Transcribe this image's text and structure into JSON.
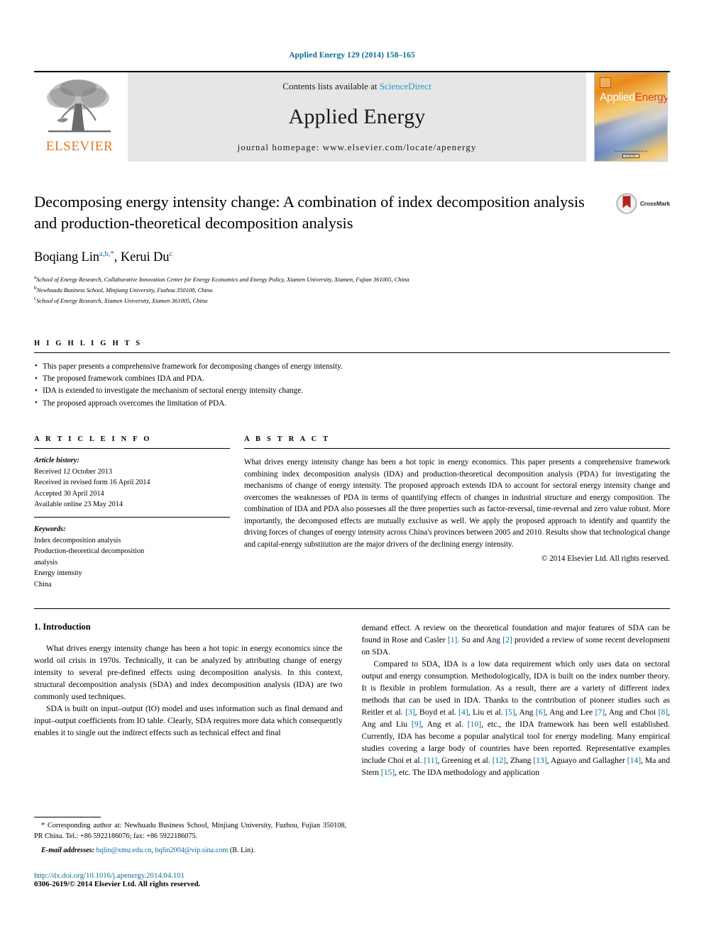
{
  "running_head": "Applied Energy 129 (2014) 158–165",
  "masthead": {
    "publisher_name": "ELSEVIER",
    "contents_prefix": "Contents lists available at ",
    "contents_link": "ScienceDirect",
    "journal_name": "Applied Energy",
    "homepage": "journal homepage: www.elsevier.com/locate/apenergy",
    "cover": {
      "title_a": "Applied",
      "title_b": "Energy",
      "footer_line": "www.elsevier.com/locate/apenergy",
      "footer_box": "ELSEVIER"
    }
  },
  "article": {
    "title": "Decomposing energy intensity change: A combination of index decomposition analysis and production-theoretical decomposition analysis",
    "authors": [
      {
        "name": "Boqiang Lin",
        "sup": "a,b,*"
      },
      {
        "name": "Kerui Du",
        "sup": "c"
      }
    ],
    "authors_separator": ", ",
    "affiliations": [
      {
        "sup": "a",
        "text": "School of Energy Research, Collaborative Innovation Center for Energy Economics and Energy Policy, Xiamen University, Xiamen, Fujian 361005, China"
      },
      {
        "sup": "b",
        "text": "Newhuadu Business School, Minjiang University, Fuzhou 350108, China"
      },
      {
        "sup": "c",
        "text": "School of Energy Research, Xiamen University, Xiamen 361005, China"
      }
    ],
    "crossmark_label": "CrossMark"
  },
  "highlights": {
    "label": "H I G H L I G H T S",
    "items": [
      "This paper presents a comprehensive framework for decomposing changes of energy intensity.",
      "The proposed framework combines IDA and PDA.",
      "IDA is extended to investigate the mechanism of sectoral energy intensity change.",
      "The proposed approach overcomes the limitation of PDA."
    ]
  },
  "article_info": {
    "label": "A R T I C L E    I N F O",
    "history_label": "Article history:",
    "history": [
      "Received 12 October 2013",
      "Received in revised form 16 April 2014",
      "Accepted 30 April 2014",
      "Available online 23 May 2014"
    ],
    "keywords_label": "Keywords:",
    "keywords": [
      "Index decomposition analysis",
      "Production-theoretical decomposition",
      "analysis",
      "Energy intensity",
      "China"
    ]
  },
  "abstract": {
    "label": "A B S T R A C T",
    "text": "What drives energy intensity change has been a hot topic in energy economics. This paper presents a comprehensive framework combining index decomposition analysis (IDA) and production-theoretical decomposition analysis (PDA) for investigating the mechanisms of change of energy intensity. The proposed approach extends IDA to account for sectoral energy intensity change and overcomes the weaknesses of PDA in terms of quantifying effects of changes in industrial structure and energy composition. The combination of IDA and PDA also possesses all the three properties such as factor-reversal, time-reversal and zero value robust. More importantly, the decomposed effects are mutually exclusive as well. We apply the proposed approach to identify and quantify the driving forces of changes of energy intensity across China's provinces between 2005 and 2010. Results show that technological change and capital-energy substitution are the major drivers of the declining energy intensity.",
    "copyright": "© 2014 Elsevier Ltd. All rights reserved."
  },
  "introduction": {
    "heading": "1. Introduction",
    "left_paragraphs": [
      "What drives energy intensity change has been a hot topic in energy economics since the world oil crisis in 1970s. Technically, it can be analyzed by attributing change of energy intensity to several pre-defined effects using decomposition analysis. In this context, structural decomposition analysis (SDA) and index decomposition analysis (IDA) are two commonly used techniques.",
      "SDA is built on input–output (IO) model and uses information such as final demand and input–output coefficients from IO table. Clearly, SDA requires more data which consequently enables it to single out the indirect effects such as technical effect and final"
    ],
    "right_paragraphs": [
      "demand effect. A review on the theoretical foundation and major features of SDA can be found in Rose and Casler [1]. Su and Ang [2] provided a review of some recent development on SDA.",
      "Compared to SDA, IDA is a low data requirement which only uses data on sectoral output and energy consumption. Methodologically, IDA is built on the index number theory. It is flexible in problem formulation. As a result, there are a variety of different index methods that can be used in IDA. Thanks to the contribution of pioneer studies such as Reitler et al. [3], Boyd et al. [4], Liu et al. [5], Ang [6], Ang and Lee [7], Ang and Choi [8], Ang and Liu [9], Ang et al. [10], etc., the IDA framework has been well established. Currently, IDA has become a popular analytical tool for energy modeling. Many empirical studies covering a large body of countries have been reported. Representative examples include Choi et al. [11], Greening et al. [12], Zhang [13], Aguayo and Gallagher [14], Ma and Stern [15], etc. The IDA methodology and application"
    ]
  },
  "footnote": {
    "corresponding": "* Corresponding author at: Newhuadu Business School, Minjiang University, Fuzhou, Fujian 350108, PR China. Tel.: +86 5922186076; fax: +86 5922186075.",
    "email_label": "E-mail addresses:",
    "emails": [
      "bqlin@xmu.edu.cn",
      "bqlin2004@vip.sina.com"
    ],
    "email_suffix": "(B. Lin).",
    "doi": "http://dx.doi.org/10.1016/j.apenergy.2014.04.101",
    "issn": "0306-2619/© 2014 Elsevier Ltd. All rights reserved."
  },
  "colors": {
    "link_blue": "#0b6c9a",
    "sciencedirect_blue": "#2196cf",
    "elsevier_orange": "#E87722",
    "masthead_gray": "#e6e6e6"
  }
}
